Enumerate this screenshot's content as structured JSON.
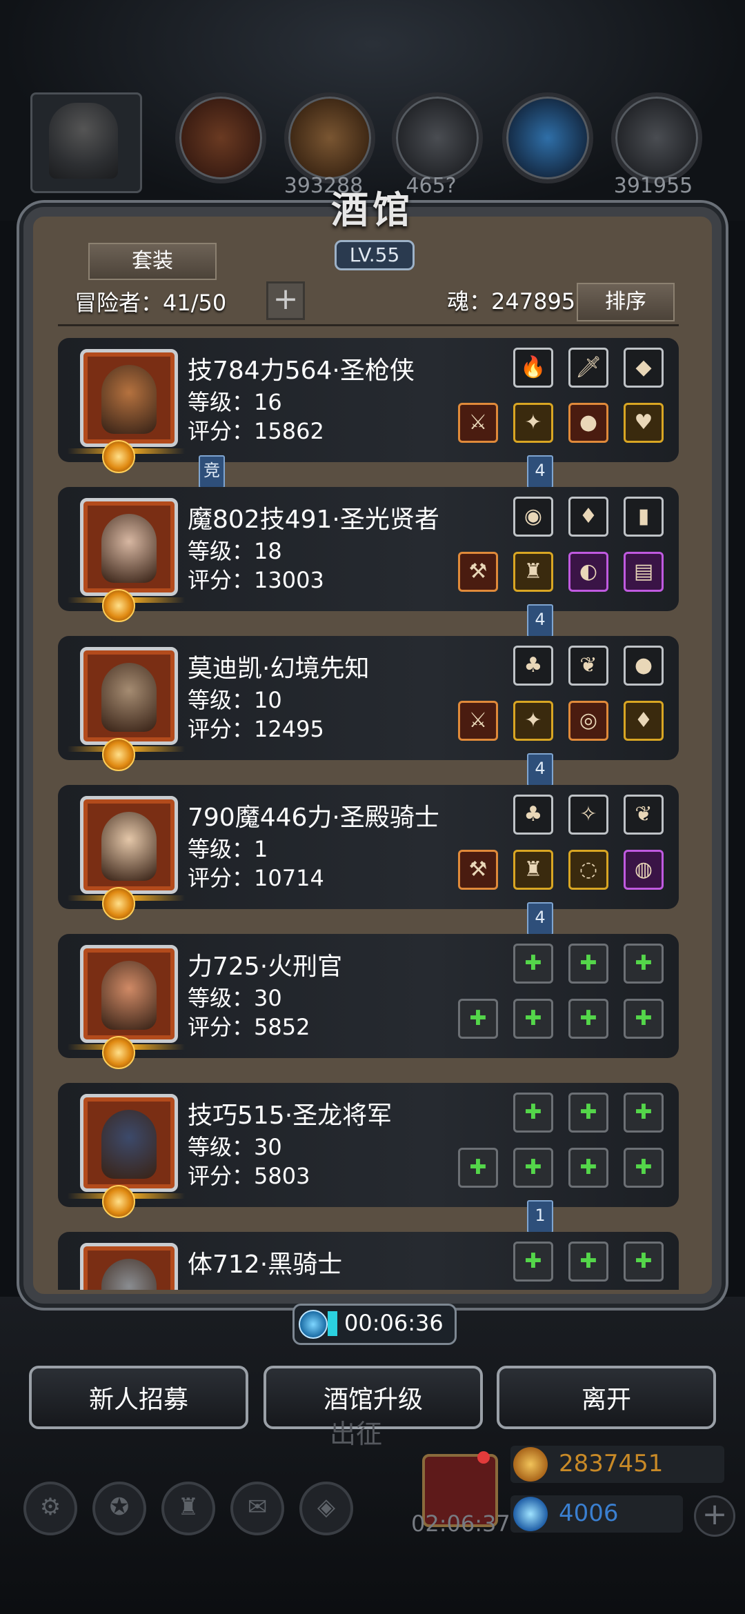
{
  "top_bar": {
    "resources": [
      "",
      "393288",
      "465?",
      "",
      "391955"
    ]
  },
  "panel": {
    "title": "酒馆",
    "level": "LV.55",
    "outfit_button": "套装",
    "adventurers_label": "冒险者：41/50",
    "soul_label": "魂：247895",
    "sort_button": "排序"
  },
  "heroes": [
    {
      "name": "技784力564·圣枪侠",
      "level": "等级：16",
      "score": "评分：15862",
      "tag_left": "竞",
      "tag_right": "4",
      "face_color": "#b5723f",
      "top_slots": [
        {
          "glyph": "🔥",
          "style": ""
        },
        {
          "glyph": "🗡",
          "style": ""
        },
        {
          "glyph": "◆",
          "style": ""
        }
      ],
      "bottom_slots": [
        {
          "glyph": "⚔",
          "style": "orange"
        },
        {
          "glyph": "✦",
          "style": "gold"
        },
        {
          "glyph": "●",
          "style": "orange"
        },
        {
          "glyph": "♥",
          "style": "gold"
        }
      ]
    },
    {
      "name": "魔802技491·圣光贤者",
      "level": "等级：18",
      "score": "评分：13003",
      "tag_left": "",
      "tag_right": "4",
      "face_color": "#d7b7a2",
      "top_slots": [
        {
          "glyph": "◉",
          "style": ""
        },
        {
          "glyph": "♦",
          "style": ""
        },
        {
          "glyph": "▮",
          "style": ""
        }
      ],
      "bottom_slots": [
        {
          "glyph": "⚒",
          "style": "orange"
        },
        {
          "glyph": "♜",
          "style": "gold"
        },
        {
          "glyph": "◐",
          "style": "purple"
        },
        {
          "glyph": "▤",
          "style": "purple"
        }
      ]
    },
    {
      "name": "莫迪凯·幻境先知",
      "level": "等级：10",
      "score": "评分：12495",
      "tag_left": "",
      "tag_right": "4",
      "face_color": "#a58c72",
      "top_slots": [
        {
          "glyph": "♣",
          "style": ""
        },
        {
          "glyph": "❦",
          "style": ""
        },
        {
          "glyph": "●",
          "style": ""
        }
      ],
      "bottom_slots": [
        {
          "glyph": "⚔",
          "style": "orange"
        },
        {
          "glyph": "✦",
          "style": "gold"
        },
        {
          "glyph": "◎",
          "style": "orange"
        },
        {
          "glyph": "♦",
          "style": "gold"
        }
      ]
    },
    {
      "name": "790魔446力·圣殿骑士",
      "level": "等级：1",
      "score": "评分：10714",
      "tag_left": "",
      "tag_right": "4",
      "face_color": "#e4c7a9",
      "top_slots": [
        {
          "glyph": "♣",
          "style": ""
        },
        {
          "glyph": "✧",
          "style": ""
        },
        {
          "glyph": "❦",
          "style": ""
        }
      ],
      "bottom_slots": [
        {
          "glyph": "⚒",
          "style": "orange"
        },
        {
          "glyph": "♜",
          "style": "gold"
        },
        {
          "glyph": "◌",
          "style": "gold"
        },
        {
          "glyph": "◍",
          "style": "purple"
        }
      ]
    },
    {
      "name": "力725·火刑官",
      "level": "等级：30",
      "score": "评分：5852",
      "tag_left": "",
      "tag_right": "",
      "face_color": "#d08a66",
      "top_slots": [
        {
          "glyph": "✚",
          "style": "empty"
        },
        {
          "glyph": "✚",
          "style": "empty"
        },
        {
          "glyph": "✚",
          "style": "empty"
        }
      ],
      "bottom_slots": [
        {
          "glyph": "✚",
          "style": "empty"
        },
        {
          "glyph": "✚",
          "style": "empty"
        },
        {
          "glyph": "✚",
          "style": "empty"
        },
        {
          "glyph": "✚",
          "style": "empty"
        }
      ]
    },
    {
      "name": "技巧515·圣龙将军",
      "level": "等级：30",
      "score": "评分：5803",
      "tag_left": "",
      "tag_right": "1",
      "face_color": "#3c4a6b",
      "top_slots": [
        {
          "glyph": "✚",
          "style": "empty"
        },
        {
          "glyph": "✚",
          "style": "empty"
        },
        {
          "glyph": "✚",
          "style": "empty"
        }
      ],
      "bottom_slots": [
        {
          "glyph": "✚",
          "style": "empty"
        },
        {
          "glyph": "✚",
          "style": "empty"
        },
        {
          "glyph": "✚",
          "style": "empty"
        },
        {
          "glyph": "✚",
          "style": "empty"
        }
      ]
    },
    {
      "name": "体712·黑骑士",
      "level": "",
      "score": "",
      "tag_left": "",
      "tag_right": "",
      "face_color": "#8a8d91",
      "top_slots": [
        {
          "glyph": "✚",
          "style": "empty"
        },
        {
          "glyph": "✚",
          "style": "empty"
        },
        {
          "glyph": "✚",
          "style": "empty"
        }
      ],
      "bottom_slots": []
    }
  ],
  "timer": {
    "value": "00:06:36"
  },
  "buttons": {
    "recruit": "新人招募",
    "upgrade": "酒馆升级",
    "leave": "离开"
  },
  "bottom_hud": {
    "expedition": "出征",
    "gift_timer": "02:06:37",
    "gold": "2837451",
    "gems": "4006",
    "gold_color": "#c98a27",
    "gem_color": "#3a7fd0"
  }
}
